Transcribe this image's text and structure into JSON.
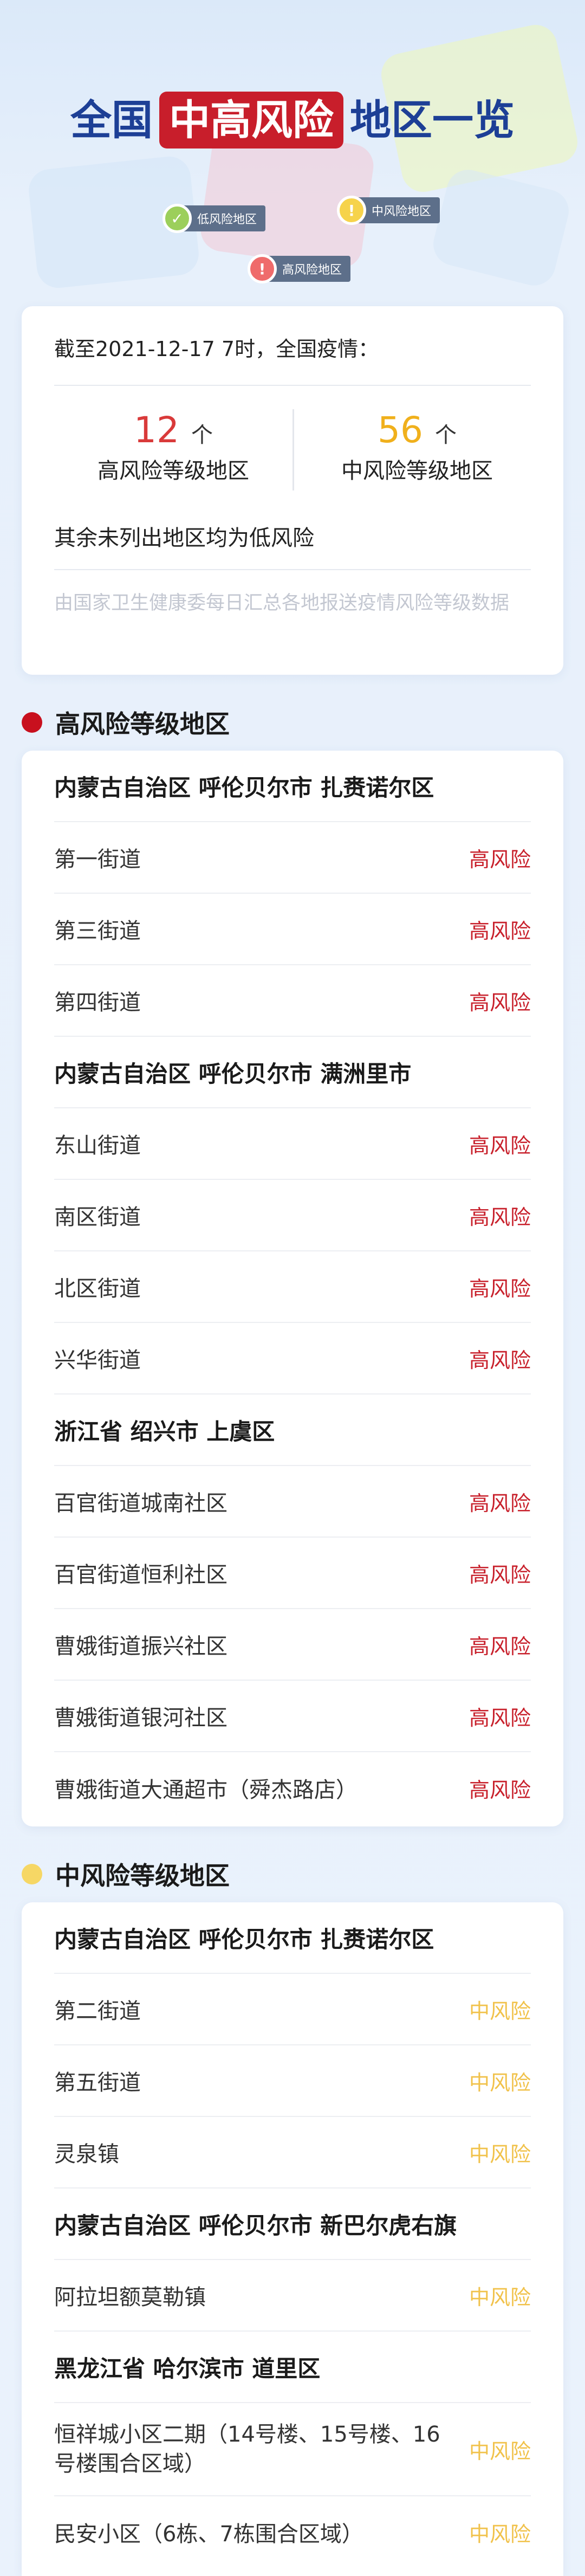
{
  "header": {
    "title_prefix": "全国",
    "title_highlight": "中高风险",
    "title_suffix": "地区一览",
    "legend": [
      {
        "label": "低风险地区",
        "color": "#9ccf5b",
        "icon": "check-icon"
      },
      {
        "label": "中风险地区",
        "color": "#f6d34b",
        "icon": "exclamation-icon"
      },
      {
        "label": "高风险地区",
        "color": "#ef6b6b",
        "icon": "exclamation-icon"
      }
    ]
  },
  "summary": {
    "date_line": "截至2021-12-17 7时，全国疫情：",
    "high": {
      "count": "12",
      "unit": "个",
      "label": "高风险等级地区",
      "color": "#d93a3a"
    },
    "mid": {
      "count": "56",
      "unit": "个",
      "label": "中风险等级地区",
      "color": "#f0b01c"
    },
    "others": "其余未列出地区均为低风险",
    "note": "由国家卫生健康委每日汇总各地报送疫情风险等级数据"
  },
  "high_section": {
    "heading": "高风险等级地区",
    "bullet_color": "#c8101e",
    "rows": [
      {
        "type": "group",
        "name": "内蒙古自治区 呼伦贝尔市 扎赉诺尔区"
      },
      {
        "type": "item",
        "name": "第一街道",
        "level": "高风险"
      },
      {
        "type": "item",
        "name": "第三街道",
        "level": "高风险"
      },
      {
        "type": "item",
        "name": "第四街道",
        "level": "高风险"
      },
      {
        "type": "group",
        "name": "内蒙古自治区 呼伦贝尔市 满洲里市"
      },
      {
        "type": "item",
        "name": "东山街道",
        "level": "高风险"
      },
      {
        "type": "item",
        "name": "南区街道",
        "level": "高风险"
      },
      {
        "type": "item",
        "name": "北区街道",
        "level": "高风险"
      },
      {
        "type": "item",
        "name": "兴华街道",
        "level": "高风险"
      },
      {
        "type": "group",
        "name": "浙江省 绍兴市 上虞区"
      },
      {
        "type": "item",
        "name": "百官街道城南社区",
        "level": "高风险"
      },
      {
        "type": "item",
        "name": "百官街道恒利社区",
        "level": "高风险"
      },
      {
        "type": "item",
        "name": "曹娥街道振兴社区",
        "level": "高风险"
      },
      {
        "type": "item",
        "name": "曹娥街道银河社区",
        "level": "高风险"
      },
      {
        "type": "item",
        "name": "曹娥街道大通超市（舜杰路店）",
        "level": "高风险"
      }
    ]
  },
  "mid_section": {
    "heading": "中风险等级地区",
    "bullet_color": "#f6d765",
    "rows": [
      {
        "type": "group",
        "name": "内蒙古自治区 呼伦贝尔市 扎赉诺尔区"
      },
      {
        "type": "item",
        "name": "第二街道",
        "level": "中风险"
      },
      {
        "type": "item",
        "name": "第五街道",
        "level": "中风险"
      },
      {
        "type": "item",
        "name": "灵泉镇",
        "level": "中风险"
      },
      {
        "type": "group",
        "name": "内蒙古自治区 呼伦贝尔市 新巴尔虎右旗"
      },
      {
        "type": "item",
        "name": "阿拉坦额莫勒镇",
        "level": "中风险"
      },
      {
        "type": "group",
        "name": "黑龙江省 哈尔滨市 道里区"
      },
      {
        "type": "item",
        "name": "恒祥城小区二期（14号楼、15号楼、16号楼围合区域）",
        "level": "中风险",
        "tall": true
      },
      {
        "type": "item",
        "name": "民安小区（6栋、7栋围合区域）",
        "level": "中风险"
      }
    ]
  }
}
